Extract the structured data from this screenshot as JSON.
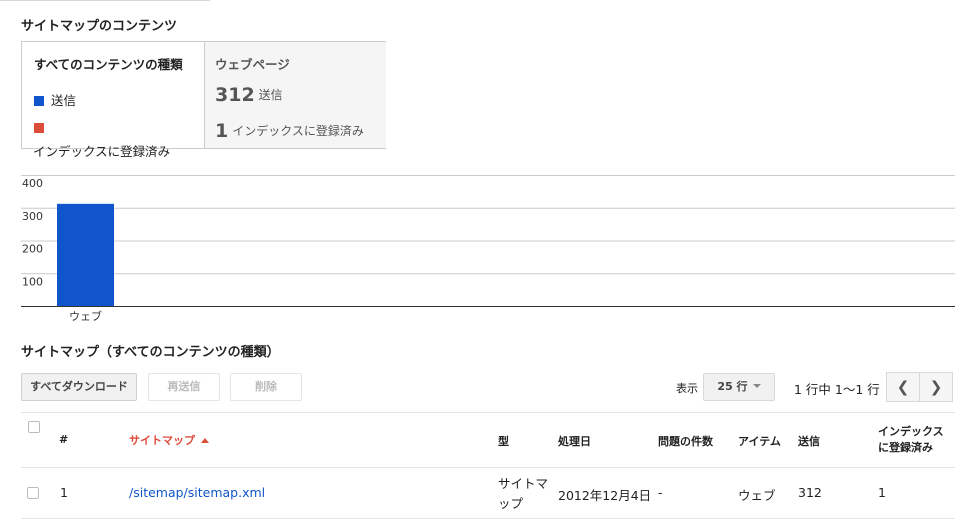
{
  "contents_heading": "サイトマップのコンテンツ",
  "panel": {
    "left_title": "すべてのコンテンツの種類",
    "legend": [
      {
        "label": "送信",
        "color": "#1155cc"
      },
      {
        "label": "インデックスに登録済み",
        "color": "#dd4b39"
      }
    ],
    "right_title": "ウェブページ",
    "stats": [
      {
        "value": "312",
        "label": "送信"
      },
      {
        "value": "1",
        "label": "インデックスに登録済み"
      }
    ]
  },
  "chart_data": {
    "type": "bar",
    "categories": [
      "ウェブ"
    ],
    "series": [
      {
        "name": "送信",
        "values": [
          312
        ],
        "color": "#1155cc"
      },
      {
        "name": "インデックスに登録済み",
        "values": [
          1
        ],
        "color": "#dd4b39"
      }
    ],
    "ylim": [
      0,
      400
    ],
    "yticks": [
      100,
      200,
      300,
      400
    ],
    "grid": true
  },
  "table_heading": "サイトマップ（すべてのコンテンツの種類）",
  "toolbar": {
    "download_label": "すべてダウンロード",
    "resubmit_label": "再送信",
    "delete_label": "削除",
    "show_label": "表示",
    "rows_value": "25 行",
    "pager_text": "1 行中 1〜1 行"
  },
  "table": {
    "headers": {
      "num": "#",
      "sitemap": "サイトマップ",
      "type": "型",
      "processed": "処理日",
      "issues": "問題の件数",
      "items": "アイテム",
      "submitted": "送信",
      "indexed_line1": "インデックス",
      "indexed_line2": "に登録済み"
    },
    "rows": [
      {
        "num": "1",
        "sitemap": "/sitemap/sitemap.xml",
        "type_line1": "サイトマ",
        "type_line2": "ップ",
        "processed": "2012年12月4日",
        "issues": "-",
        "items": "ウェブ",
        "submitted": "312",
        "indexed": "1"
      }
    ]
  }
}
